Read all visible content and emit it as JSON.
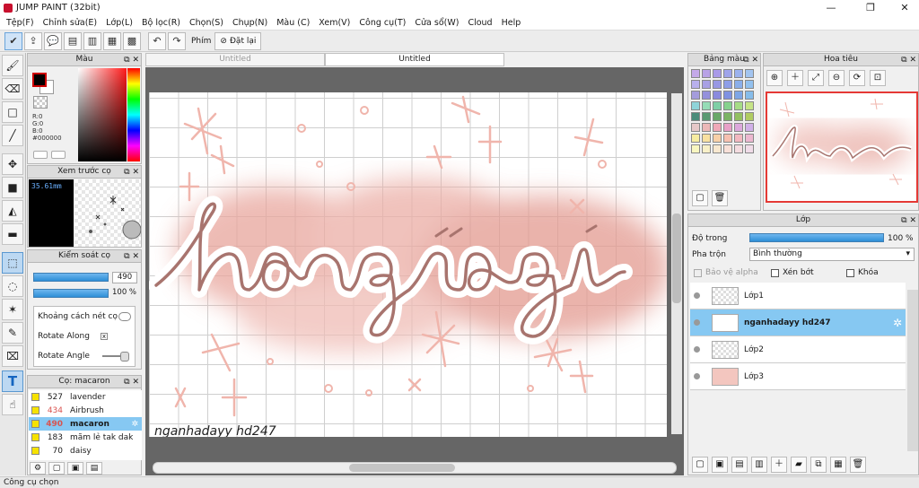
{
  "window": {
    "title": "JUMP PAINT (32bit)"
  },
  "menu": [
    "Tệp(F)",
    "Chỉnh sửa(E)",
    "Lớp(L)",
    "Bộ lọc(R)",
    "Chọn(S)",
    "Chụp(N)",
    "Màu (C)",
    "Xem(V)",
    "Công cụ(T)",
    "Cửa sổ(W)",
    "Cloud",
    "Help"
  ],
  "toolbar": {
    "key_label": "Phím",
    "reset_label": "Đặt lại"
  },
  "color_panel": {
    "title": "Màu",
    "r": "R:0",
    "g": "G:0",
    "b": "B:0",
    "hex": "#000000"
  },
  "preview_panel": {
    "title": "Xem trước cọ",
    "size": "35.61mm"
  },
  "control_panel": {
    "title": "Kiểm soát cọ",
    "size_value": "490",
    "opacity_value": "100 %",
    "options": [
      "Khoảng cách nét cọ",
      "Rotate Along",
      "Rotate Angle"
    ]
  },
  "brush_panel": {
    "title": "Cọ: macaron",
    "brushes": [
      {
        "size": "527",
        "name": "lavender"
      },
      {
        "size": "434",
        "name": "Airbrush"
      },
      {
        "size": "490",
        "name": "macaron"
      },
      {
        "size": "183",
        "name": "mãm lẻ tak dak"
      },
      {
        "size": "70",
        "name": "daisy"
      }
    ]
  },
  "tabs": [
    "Untitled",
    "Untitled"
  ],
  "canvas": {
    "watermark": "nganhadayy hd247",
    "art_text": "hông có gì"
  },
  "swatch_panel": {
    "title": "Bảng màu",
    "colors": [
      "#c4a9e8",
      "#b8a2e6",
      "#a99ae8",
      "#9fa4ea",
      "#9cb2ee",
      "#a2c4f0",
      "#b8b0ec",
      "#a8a0e4",
      "#9898e4",
      "#8e9ee8",
      "#8aaeea",
      "#92c0ee",
      "#a49cdc",
      "#9490dc",
      "#8a8ade",
      "#7f92e2",
      "#7ea6e6",
      "#86bcea",
      "#8fd4d9",
      "#96dcb6",
      "#7fcfa6",
      "#86d28e",
      "#a6dc86",
      "#c6e486",
      "#4b8c7a",
      "#5a9a72",
      "#6aa868",
      "#7cb464",
      "#93c062",
      "#b0cc62",
      "#e6c8c8",
      "#ecb8b8",
      "#f0a8b8",
      "#e8a0c8",
      "#dca8dc",
      "#d0b0e8",
      "#f6eca0",
      "#f8e0a0",
      "#f8d0a8",
      "#f6c0b0",
      "#f2b8c0",
      "#ecb8d0",
      "#f8f6c0",
      "#f8f0c8",
      "#f8e8d0",
      "#f8e0d8",
      "#f4dce0",
      "#f0dce8"
    ]
  },
  "nav_panel": {
    "title": "Hoa tiêu"
  },
  "layer_panel": {
    "title": "Lớp",
    "opacity_label": "Độ trong",
    "opacity_value": "100 %",
    "opacity_level": 1.0,
    "blend_label": "Pha trộn",
    "blend_value": "Bình thường",
    "protect_alpha": "Bảo vệ alpha",
    "clipping": "Xén bớt",
    "lock": "Khóa",
    "layers": [
      {
        "name": "Lớp1"
      },
      {
        "name": "nganhadayy hd247"
      },
      {
        "name": "Lớp2"
      },
      {
        "name": "Lớp3"
      }
    ]
  },
  "status": {
    "text": "Công cụ chọn"
  }
}
